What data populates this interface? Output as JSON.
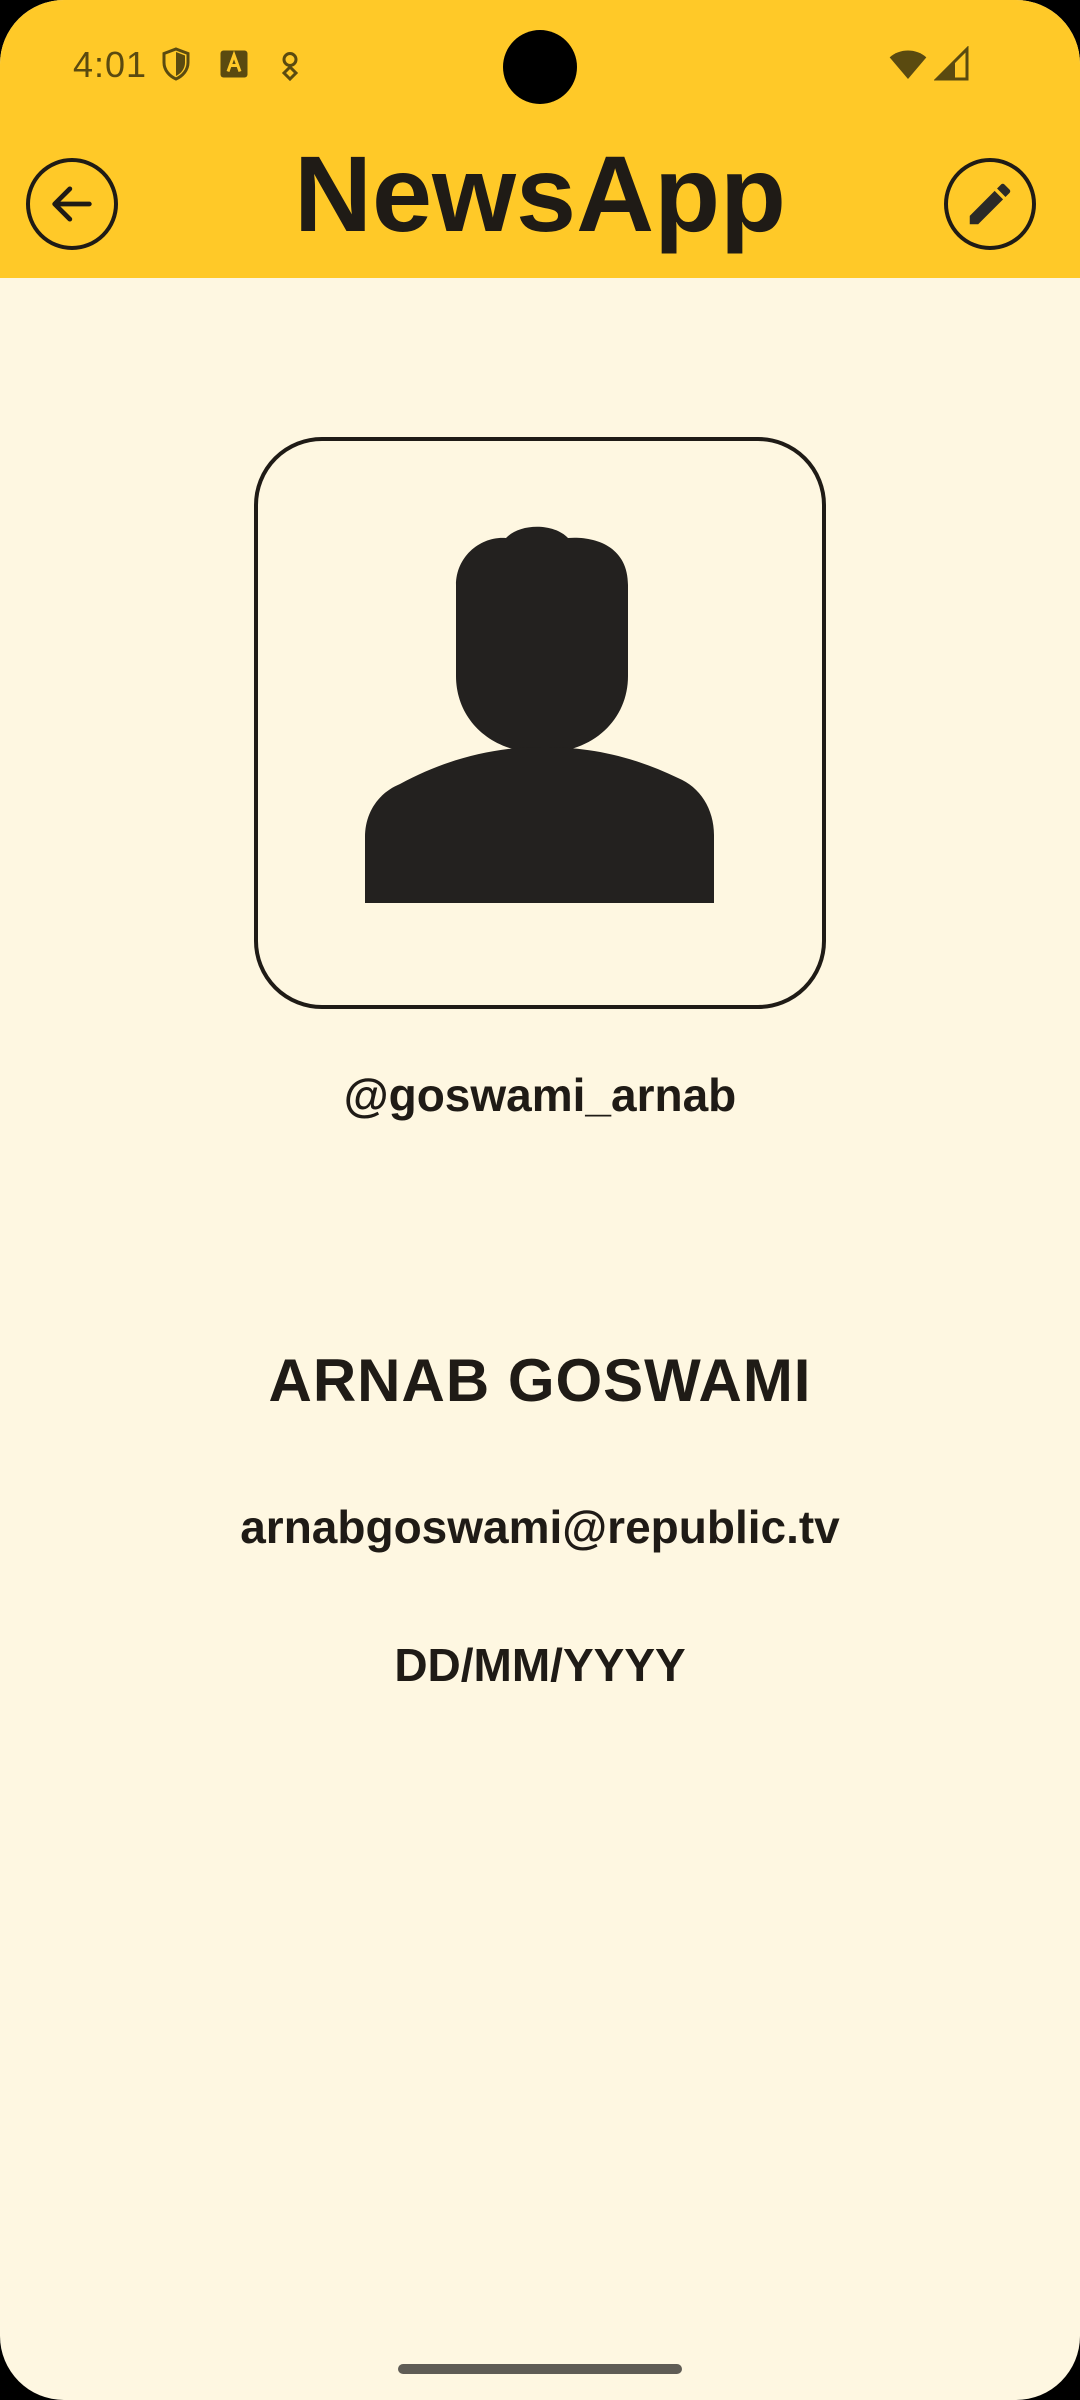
{
  "status_bar": {
    "time": "4:01",
    "left_icons": [
      "shield-icon",
      "text-a-icon",
      "location-pin-icon"
    ],
    "right_icons": [
      "wifi-icon",
      "signal-icon"
    ]
  },
  "app_bar": {
    "title": "NewsApp",
    "back_icon": "arrow-left-icon",
    "edit_icon": "pencil-icon"
  },
  "profile": {
    "avatar_icon": "person-icon",
    "username": "@goswami_arnab",
    "full_name": "ARNAB GOSWAMI",
    "email": "arnabgoswami@republic.tv",
    "date_of_birth": "DD/MM/YYYY"
  },
  "colors": {
    "app_bar_bg": "#FFC928",
    "page_bg": "#FEF7E1",
    "text": "#1F1B16"
  }
}
